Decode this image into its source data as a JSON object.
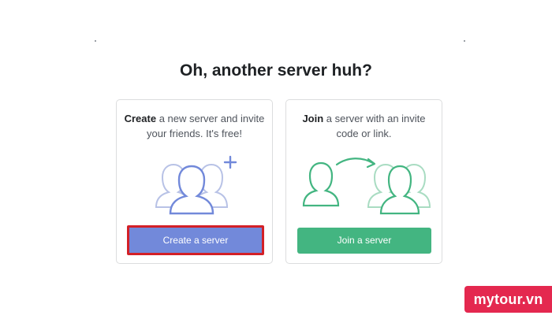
{
  "heading": "Oh, another server huh?",
  "create_card": {
    "desc_bold": "Create",
    "desc_rest": " a new server and invite your friends. It's free!",
    "button_label": "Create a server",
    "accent": "#7289da",
    "highlight": "#d32027",
    "icon": "users-plus-icon"
  },
  "join_card": {
    "desc_bold": "Join",
    "desc_rest": " a server with an invite code or link.",
    "button_label": "Join a server",
    "accent": "#43b581",
    "icon": "join-users-icon"
  },
  "watermark": "mytour.vn",
  "colors": {
    "background": "#ffffff",
    "heading": "#1e2124",
    "watermark": "#e4284f"
  }
}
